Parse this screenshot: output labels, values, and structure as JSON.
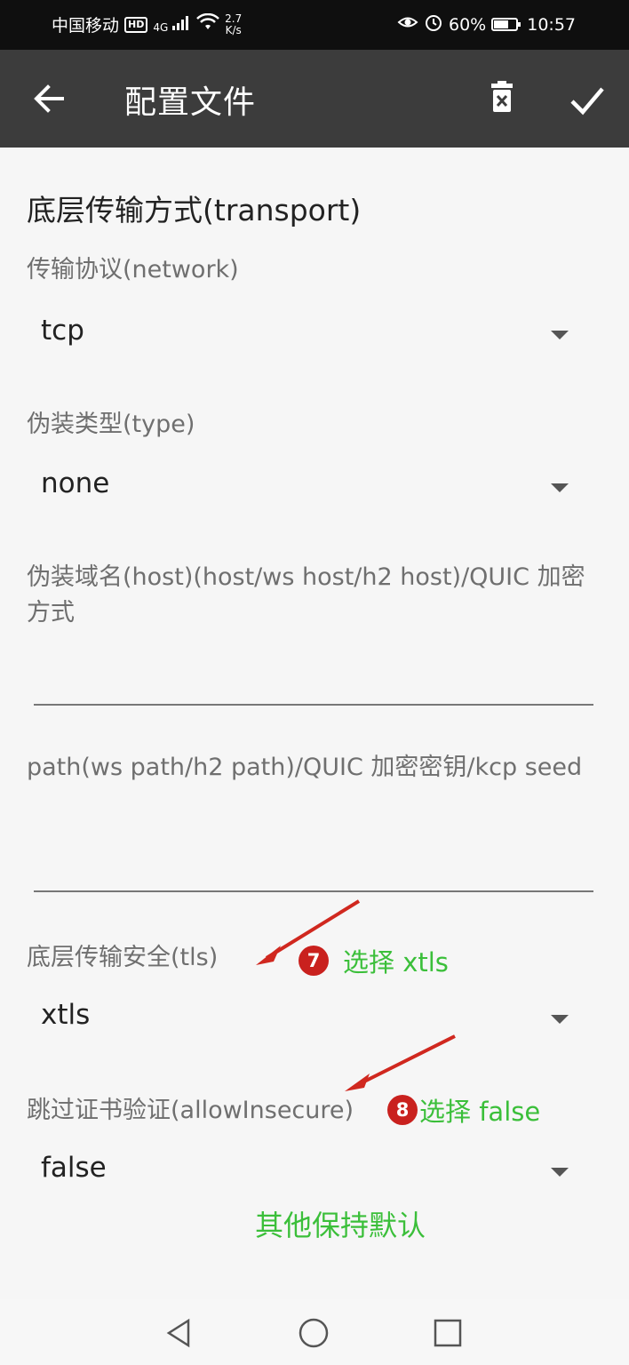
{
  "status_bar": {
    "carrier": "中国移动",
    "hd": "HD",
    "network_type": "4G",
    "speed_value": "2.7",
    "speed_unit": "K/s",
    "battery": "60%",
    "battery_level": 0.6,
    "time": "10:57"
  },
  "app_bar": {
    "title": "配置文件",
    "icons": {
      "back": "arrow-back-icon",
      "delete": "trash-icon",
      "confirm": "check-icon"
    }
  },
  "form": {
    "section_title": "底层传输方式(transport)",
    "network": {
      "label": "传输协议(network)",
      "value": "tcp"
    },
    "type": {
      "label": "伪装类型(type)",
      "value": "none"
    },
    "host": {
      "label": "伪装域名(host)(host/ws host/h2 host)/QUIC 加密方式",
      "value": ""
    },
    "path": {
      "label": "path(ws path/h2 path)/QUIC 加密密钥/kcp seed",
      "value": ""
    },
    "tls": {
      "label": "底层传输安全(tls)",
      "value": "xtls"
    },
    "allow_insecure": {
      "label": "跳过证书验证(allowInsecure)",
      "value": "false"
    }
  },
  "annotations": {
    "step7": {
      "number": "7",
      "text": "选择 xtls"
    },
    "step8": {
      "number": "8",
      "text": "选择 false"
    },
    "note": "其他保持默认",
    "colors": {
      "text": "#3bbf3a",
      "badge": "#c9211e",
      "arrow": "#d0281f"
    }
  },
  "nav_bar": {
    "icons": [
      "back-triangle-icon",
      "home-circle-icon",
      "recents-square-icon"
    ]
  }
}
